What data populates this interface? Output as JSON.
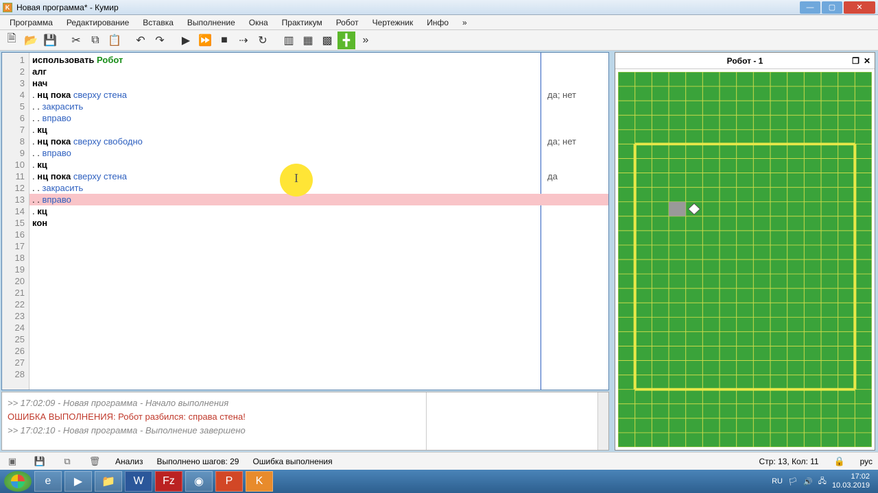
{
  "window": {
    "title": "Новая программа* - Кумир",
    "app_icon_letter": "K"
  },
  "menu": [
    "Программа",
    "Редактирование",
    "Вставка",
    "Выполнение",
    "Окна",
    "Практикум",
    "Робот",
    "Чертежник",
    "Инфо",
    "»"
  ],
  "code": {
    "lines": [
      {
        "n": 1,
        "tokens": [
          {
            "t": "использовать ",
            "c": "kw"
          },
          {
            "t": "Робот",
            "c": "green"
          }
        ]
      },
      {
        "n": 2,
        "tokens": [
          {
            "t": "алг",
            "c": "kw"
          }
        ]
      },
      {
        "n": 3,
        "tokens": [
          {
            "t": "нач",
            "c": "kw"
          }
        ]
      },
      {
        "n": 4,
        "tokens": [
          {
            "t": ". ",
            "c": ""
          },
          {
            "t": "нц пока ",
            "c": "kw"
          },
          {
            "t": "сверху стена",
            "c": "ident"
          }
        ]
      },
      {
        "n": 5,
        "tokens": [
          {
            "t": ". . ",
            "c": ""
          },
          {
            "t": "закрасить",
            "c": "ident"
          }
        ]
      },
      {
        "n": 6,
        "tokens": [
          {
            "t": ". . ",
            "c": ""
          },
          {
            "t": "вправо",
            "c": "ident"
          }
        ]
      },
      {
        "n": 7,
        "tokens": [
          {
            "t": ". ",
            "c": ""
          },
          {
            "t": "кц",
            "c": "kw"
          }
        ]
      },
      {
        "n": 8,
        "tokens": [
          {
            "t": ". ",
            "c": ""
          },
          {
            "t": "нц пока ",
            "c": "kw"
          },
          {
            "t": "сверху свободно",
            "c": "ident"
          }
        ]
      },
      {
        "n": 9,
        "tokens": [
          {
            "t": ". . ",
            "c": ""
          },
          {
            "t": "вправо",
            "c": "ident"
          }
        ]
      },
      {
        "n": 10,
        "tokens": [
          {
            "t": ". ",
            "c": ""
          },
          {
            "t": "кц",
            "c": "kw"
          }
        ]
      },
      {
        "n": 11,
        "tokens": [
          {
            "t": ". ",
            "c": ""
          },
          {
            "t": "нц пока ",
            "c": "kw"
          },
          {
            "t": "сверху стена",
            "c": "ident"
          }
        ]
      },
      {
        "n": 12,
        "tokens": [
          {
            "t": ". . ",
            "c": ""
          },
          {
            "t": "закрасить",
            "c": "ident"
          }
        ]
      },
      {
        "n": 13,
        "tokens": [
          {
            "t": ". . ",
            "c": ""
          },
          {
            "t": "вправо",
            "c": "ident"
          }
        ],
        "hl": true
      },
      {
        "n": 14,
        "tokens": [
          {
            "t": ". ",
            "c": ""
          },
          {
            "t": "кц",
            "c": "kw"
          }
        ]
      },
      {
        "n": 15,
        "tokens": [
          {
            "t": "кон",
            "c": "kw"
          }
        ]
      },
      {
        "n": 16,
        "tokens": []
      },
      {
        "n": 17,
        "tokens": []
      },
      {
        "n": 18,
        "tokens": []
      },
      {
        "n": 19,
        "tokens": []
      },
      {
        "n": 20,
        "tokens": []
      },
      {
        "n": 21,
        "tokens": []
      },
      {
        "n": 22,
        "tokens": []
      },
      {
        "n": 23,
        "tokens": []
      },
      {
        "n": 24,
        "tokens": []
      },
      {
        "n": 25,
        "tokens": []
      },
      {
        "n": 26,
        "tokens": []
      },
      {
        "n": 27,
        "tokens": []
      },
      {
        "n": 28,
        "tokens": []
      }
    ],
    "margin_notes": {
      "4": "да; нет",
      "8": "да; нет",
      "11": "да"
    }
  },
  "console": {
    "line1": ">> 17:02:09 - Новая программа - Начало выполнения",
    "error": "ОШИБКА ВЫПОЛНЕНИЯ: Робот разбился: справа стена!",
    "line2": ">> 17:02:10 - Новая программа - Выполнение завершено"
  },
  "robot": {
    "title": "Робот - 1",
    "grid_cols": 15,
    "grid_rows": 26,
    "filled_cell": {
      "col": 3,
      "row": 9
    },
    "robot_pos": {
      "col": 4,
      "row": 9
    }
  },
  "status": {
    "analysis": "Анализ",
    "steps": "Выполнено шагов: 29",
    "error": "Ошибка выполнения",
    "cursor": "Стр: 13, Кол: 11",
    "lang": "рус"
  },
  "taskbar": {
    "lang": "RU",
    "time": "17:02",
    "date": "10.03.2019"
  }
}
